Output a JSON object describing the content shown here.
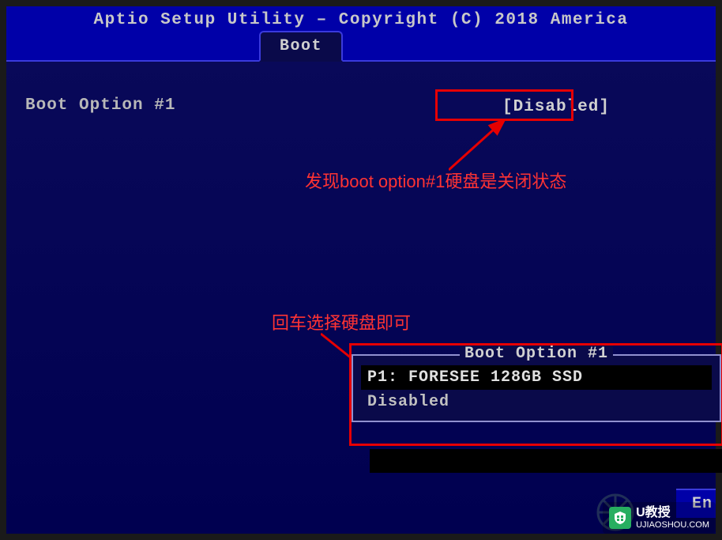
{
  "header": {
    "title": "Aptio Setup Utility – Copyright (C) 2018 America"
  },
  "tabs": {
    "boot": "Boot"
  },
  "settings": {
    "boot_option_1": {
      "label": "Boot Option #1",
      "value": "[Disabled]"
    }
  },
  "annotations": {
    "note1": "发现boot option#1硬盘是关闭状态",
    "note2": "回车选择硬盘即可"
  },
  "popup": {
    "title": "Boot Option #1",
    "options": [
      "P1: FORESEE 128GB SSD",
      "Disabled"
    ],
    "selected_index": 0
  },
  "footer": {
    "partial": "En"
  },
  "watermark": {
    "title": "U教授",
    "url": "UJIAOSHOU.COM"
  }
}
